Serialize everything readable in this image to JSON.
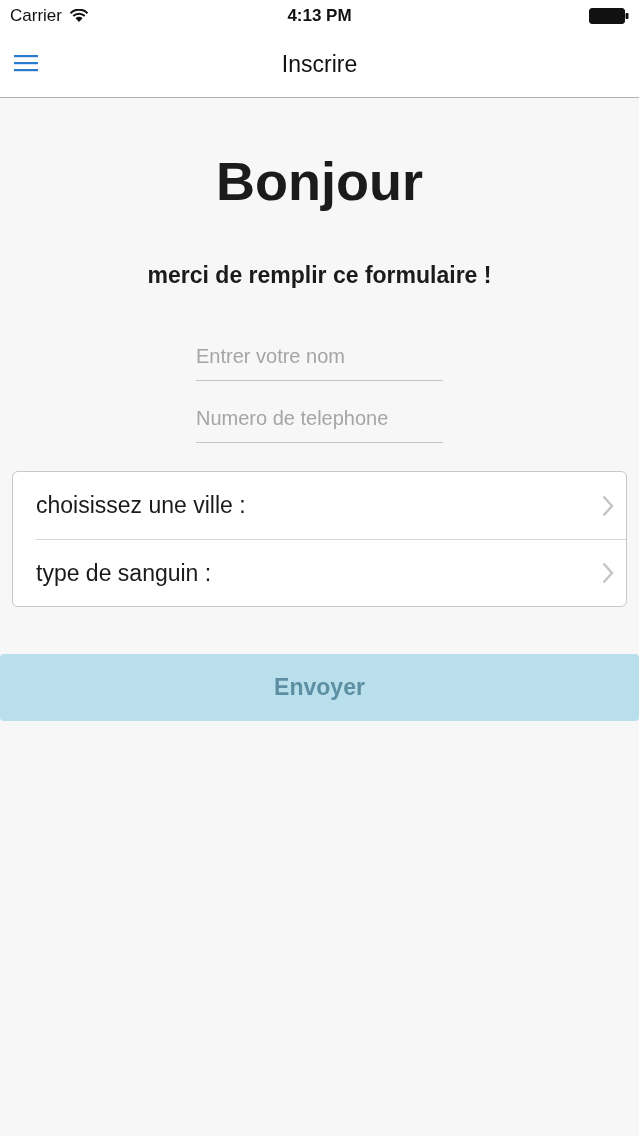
{
  "status_bar": {
    "carrier": "Carrier",
    "time": "4:13 PM"
  },
  "nav_bar": {
    "title": "Inscrire"
  },
  "heading": "Bonjour",
  "subheading": "merci de remplir ce formulaire !",
  "fields": [
    {
      "placeholder": "Entrer votre nom"
    },
    {
      "placeholder": "Numero de telephone"
    }
  ],
  "options": [
    {
      "label": "choisissez une ville :"
    },
    {
      "label": "type de sanguin :"
    }
  ],
  "submit": {
    "label": "Envoyer",
    "disabled": true
  }
}
